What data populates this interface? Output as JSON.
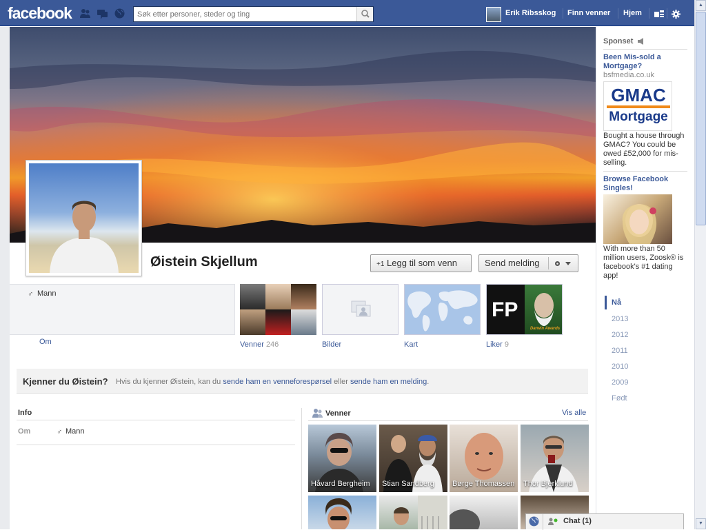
{
  "topbar": {
    "logo": "facebook",
    "search_placeholder": "Søk etter personer, steder og ting",
    "user_name": "Erik Ribsskog",
    "nav": [
      "Finn venner",
      "Hjem"
    ]
  },
  "profile": {
    "name": "Øistein Skjellum",
    "add_friend_label": "Legg til som venn",
    "add_friend_prefix": "+1",
    "message_label": "Send melding",
    "gender": "Mann",
    "about_link": "Om"
  },
  "tiles": {
    "friends_label": "Venner",
    "friends_count": "246",
    "photos_label": "Bilder",
    "map_label": "Kart",
    "likes_label": "Liker",
    "likes_count": "9",
    "likes_thumb_text": "Darwin Awards"
  },
  "know_box": {
    "title": "Kjenner du Øistein?",
    "text_before": "Hvis du kjenner Øistein, kan du",
    "link1": "sende ham en venneforespørsel",
    "text_mid": "eller",
    "link2": "sende ham en melding",
    "text_after": "."
  },
  "info": {
    "title": "Info",
    "row_label": "Om",
    "row_value": "Mann"
  },
  "friends_section": {
    "title": "Venner",
    "see_all": "Vis alle",
    "friends": [
      {
        "name": "Håvard Bergheim"
      },
      {
        "name": "Stian Sandberg"
      },
      {
        "name": "Børge Thomassen"
      },
      {
        "name": "Thor Bjerklund"
      }
    ]
  },
  "sidebar": {
    "sponsored": "Sponset",
    "ad1": {
      "title": "Been Mis-sold a Mortgage?",
      "source": "bsfmedia.co.uk",
      "logo_line1": "GMAC",
      "logo_line2": "Mortgage",
      "body": "Bought a house through GMAC? You could be owed £52,000 for mis-selling."
    },
    "ad2": {
      "title": "Browse Facebook Singles!",
      "body": "With more than 50 million users, Zoosk® is facebook's #1 dating app!"
    },
    "timeline": [
      "Nå",
      "2013",
      "2012",
      "2011",
      "2010",
      "2009",
      "Født"
    ]
  },
  "chat": {
    "label": "Chat (1)"
  },
  "colors": {
    "brand": "#3b5998",
    "link": "#3b5998",
    "online": "#42b72a"
  }
}
